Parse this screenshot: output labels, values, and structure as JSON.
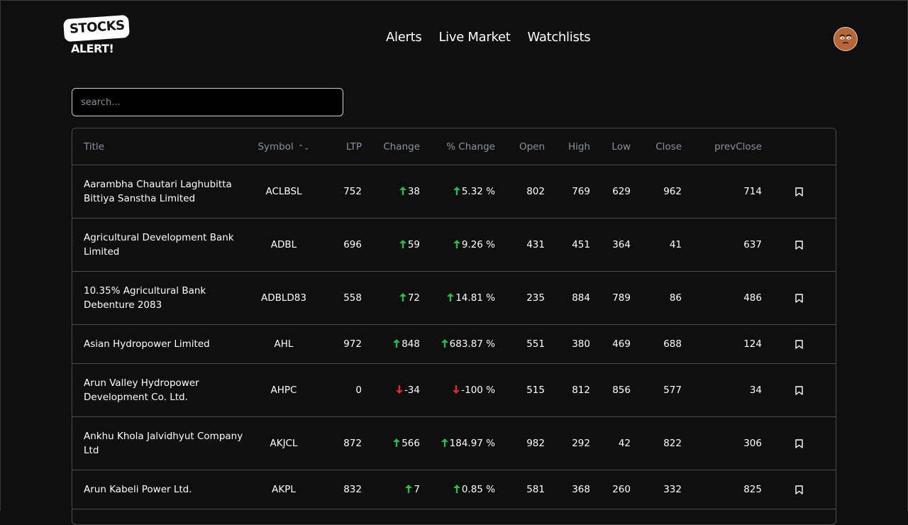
{
  "brand": {
    "line1": "STOCKS",
    "line2": "ALERT!"
  },
  "nav": [
    {
      "label": "Alerts"
    },
    {
      "label": "Live Market"
    },
    {
      "label": "Watchlists"
    }
  ],
  "search": {
    "placeholder": "search...",
    "value": ""
  },
  "table": {
    "headers": {
      "title": "Title",
      "symbol": "Symbol",
      "ltp": "LTP",
      "change": "Change",
      "pct_change": "% Change",
      "open": "Open",
      "high": "High",
      "low": "Low",
      "close": "Close",
      "prev_close": "prevClose"
    },
    "rows": [
      {
        "title": "Aarambha Chautari Laghubitta Bittiya Sanstha Limited",
        "symbol": "ACLBSL",
        "ltp": "752",
        "direction": "up",
        "change": "38",
        "pct_change": "5.32 %",
        "open": "802",
        "high": "769",
        "low": "629",
        "close": "962",
        "prev_close": "714"
      },
      {
        "title": "Agricultural Development Bank Limited",
        "symbol": "ADBL",
        "ltp": "696",
        "direction": "up",
        "change": "59",
        "pct_change": "9.26 %",
        "open": "431",
        "high": "451",
        "low": "364",
        "close": "41",
        "prev_close": "637"
      },
      {
        "title": "10.35% Agricultural Bank Debenture 2083",
        "symbol": "ADBLD83",
        "ltp": "558",
        "direction": "up",
        "change": "72",
        "pct_change": "14.81 %",
        "open": "235",
        "high": "884",
        "low": "789",
        "close": "86",
        "prev_close": "486"
      },
      {
        "title": "Asian Hydropower Limited",
        "symbol": "AHL",
        "ltp": "972",
        "direction": "up",
        "change": "848",
        "pct_change": "683.87 %",
        "open": "551",
        "high": "380",
        "low": "469",
        "close": "688",
        "prev_close": "124"
      },
      {
        "title": "Arun Valley Hydropower Development Co. Ltd.",
        "symbol": "AHPC",
        "ltp": "0",
        "direction": "down",
        "change": "-34",
        "pct_change": "-100 %",
        "open": "515",
        "high": "812",
        "low": "856",
        "close": "577",
        "prev_close": "34"
      },
      {
        "title": "Ankhu Khola Jalvidhyut Company Ltd",
        "symbol": "AKJCL",
        "ltp": "872",
        "direction": "up",
        "change": "566",
        "pct_change": "184.97 %",
        "open": "982",
        "high": "292",
        "low": "42",
        "close": "822",
        "prev_close": "306"
      },
      {
        "title": "Arun Kabeli Power Ltd.",
        "symbol": "AKPL",
        "ltp": "832",
        "direction": "up",
        "change": "7",
        "pct_change": "0.85 %",
        "open": "581",
        "high": "368",
        "low": "260",
        "close": "332",
        "prev_close": "825"
      }
    ]
  },
  "icons": {
    "sort": "sort-icon",
    "up": "arrow-up-icon",
    "down": "arrow-down-icon",
    "bookmark": "bookmark-icon",
    "avatar": "avatar"
  },
  "colors": {
    "background": "#0f0f10",
    "up": "#2db84d",
    "down": "#e02b2b",
    "header_text": "#8a92a0",
    "border": "#4a4a4a"
  }
}
